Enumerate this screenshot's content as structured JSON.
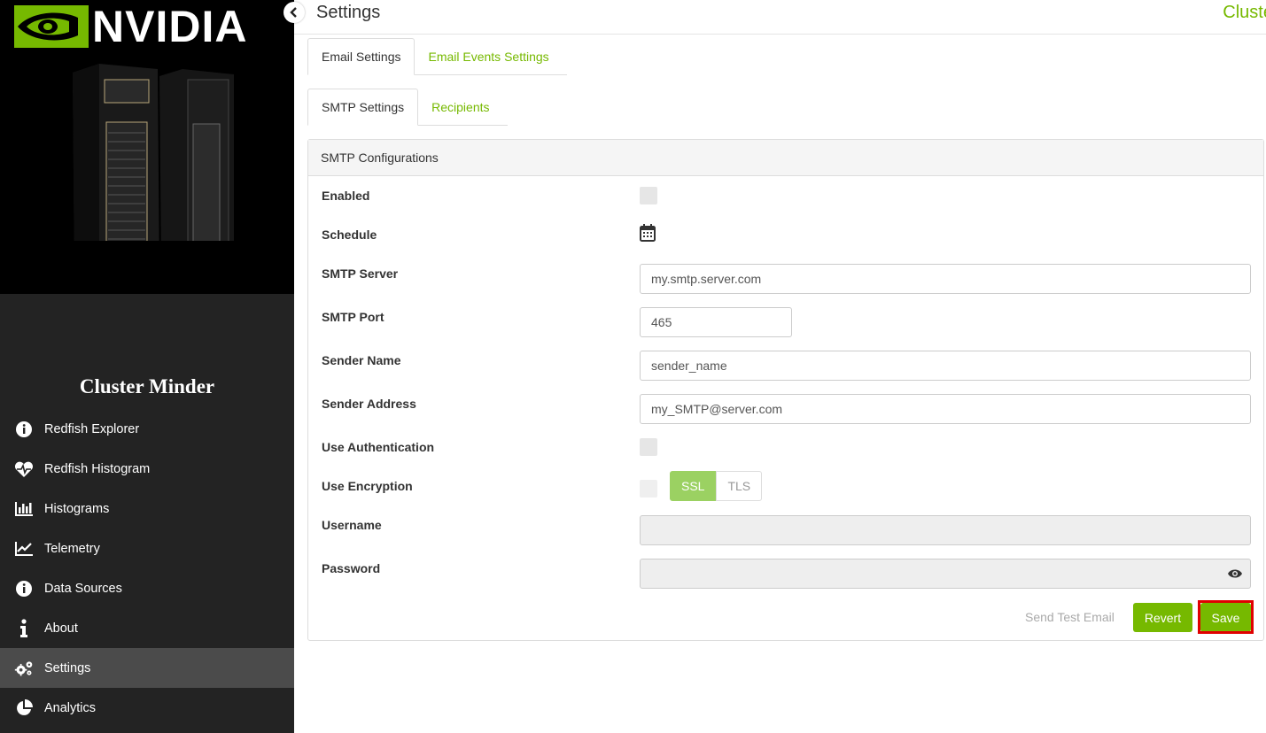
{
  "brand": {
    "name": "NVIDIA"
  },
  "sidebar": {
    "app_title": "Cluster Minder",
    "items": [
      {
        "label": "Redfish Explorer",
        "icon": "info-circle-icon"
      },
      {
        "label": "Redfish Histogram",
        "icon": "heartbeat-icon"
      },
      {
        "label": "Histograms",
        "icon": "bar-chart-icon"
      },
      {
        "label": "Telemetry",
        "icon": "line-chart-icon"
      },
      {
        "label": "Data Sources",
        "icon": "info-circle-icon"
      },
      {
        "label": "About",
        "icon": "info-icon"
      },
      {
        "label": "Settings",
        "icon": "gears-icon",
        "active": true
      },
      {
        "label": "Analytics",
        "icon": "pie-chart-icon"
      }
    ]
  },
  "header": {
    "title": "Settings",
    "right_text": "Cluste"
  },
  "tabs_top": [
    {
      "label": "Email Settings",
      "active": true
    },
    {
      "label": "Email Events Settings",
      "active": false
    }
  ],
  "tabs_sub": [
    {
      "label": "SMTP Settings",
      "active": true
    },
    {
      "label": "Recipients",
      "active": false
    }
  ],
  "panel": {
    "title": "SMTP Configurations",
    "fields": {
      "enabled": {
        "label": "Enabled",
        "checked": false
      },
      "schedule": {
        "label": "Schedule"
      },
      "smtp_server": {
        "label": "SMTP Server",
        "value": "my.smtp.server.com"
      },
      "smtp_port": {
        "label": "SMTP Port",
        "value": "465"
      },
      "sender_name": {
        "label": "Sender Name",
        "value": "sender_name"
      },
      "sender_address": {
        "label": "Sender Address",
        "value": "my_SMTP@server.com"
      },
      "use_auth": {
        "label": "Use Authentication",
        "checked": false
      },
      "use_encryption": {
        "label": "Use Encryption",
        "checked": false,
        "options": [
          "SSL",
          "TLS"
        ],
        "selected": "SSL"
      },
      "username": {
        "label": "Username",
        "value": ""
      },
      "password": {
        "label": "Password",
        "value": ""
      }
    },
    "actions": {
      "send_test": "Send Test Email",
      "revert": "Revert",
      "save": "Save"
    }
  },
  "colors": {
    "accent": "#76b900",
    "sidebar_bg": "#232323",
    "highlight": "#e00000"
  }
}
